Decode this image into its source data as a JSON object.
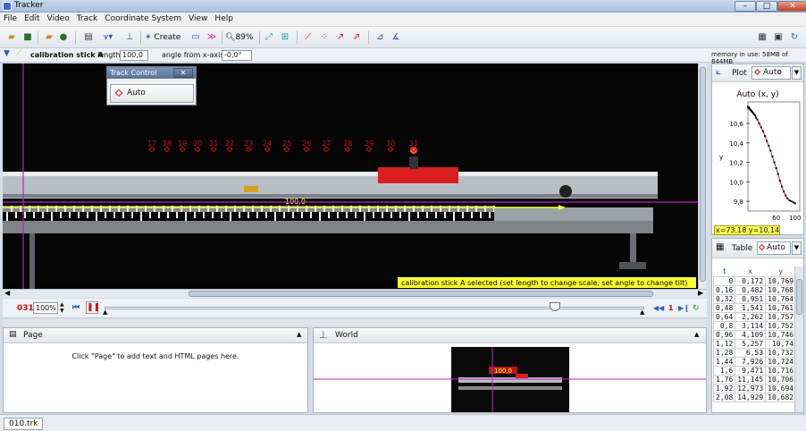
{
  "window": {
    "title": "Tracker",
    "min": "–",
    "max": "□",
    "close": "✕"
  },
  "menu": [
    "File",
    "Edit",
    "Video",
    "Track",
    "Coordinate System",
    "View",
    "Help"
  ],
  "toolbar": {
    "create_label": "Create",
    "zoom_label": "89%"
  },
  "calibration": {
    "track_name": "calibration stick A",
    "length_label": "length",
    "length_value": "100,0",
    "angle_label": "angle from x-axis",
    "angle_value": "-0,0°"
  },
  "memory": "memory in use: 58MB of 844MB",
  "track_control": {
    "title": "Track Control",
    "close": "✕",
    "button_label": "Auto"
  },
  "video": {
    "point_labels": [
      "17",
      "18",
      "19",
      "20",
      "21",
      "22",
      "23",
      "24",
      "25",
      "26",
      "27",
      "28",
      "29",
      "30",
      "31"
    ],
    "stick_value": "100,0",
    "status_message": "calibration stick A selected (set length to change scale, set angle to change tilt)"
  },
  "player": {
    "frame": "031",
    "rate": "100%",
    "step_size": "1"
  },
  "page_pane": {
    "title": "Page",
    "hint": "Click \"Page\" to add text and HTML pages here."
  },
  "world_pane": {
    "title": "World",
    "thumb_text": "100,0"
  },
  "plot": {
    "plot_label": "Plot",
    "track_label": "Auto",
    "title": "Auto (x, y)",
    "ylabel": "y",
    "y_ticks": [
      "10,6",
      "10,4",
      "10,2",
      "10,0",
      "9,8"
    ],
    "x_ticks": [
      "60",
      "100"
    ],
    "readout": "x=73,18  y=10,14"
  },
  "chart_data": {
    "type": "scatter",
    "title": "Auto (x, y)",
    "ylabel": "y",
    "xlim": [
      0,
      110
    ],
    "ylim": [
      9.7,
      10.82
    ],
    "x": [
      0.172,
      0.482,
      0.951,
      1.541,
      2.262,
      3.114,
      4.109,
      5.257,
      6.53,
      7.926,
      9.471,
      11.145,
      12.973,
      14.929,
      17.2,
      20,
      24,
      28,
      32,
      36,
      40,
      44,
      48,
      52,
      56,
      60,
      64,
      68,
      72,
      76,
      80,
      84,
      88,
      92,
      96,
      100
    ],
    "y": [
      10.769,
      10.768,
      10.764,
      10.761,
      10.757,
      10.752,
      10.746,
      10.74,
      10.732,
      10.724,
      10.716,
      10.706,
      10.694,
      10.682,
      10.66,
      10.64,
      10.6,
      10.56,
      10.52,
      10.47,
      10.42,
      10.37,
      10.32,
      10.26,
      10.2,
      10.14,
      10.08,
      10.01,
      9.95,
      9.9,
      9.86,
      9.83,
      9.81,
      9.8,
      9.79,
      9.78
    ]
  },
  "table_pane": {
    "table_label": "Table",
    "track_label": "Auto",
    "columns": [
      "t",
      "x",
      "y"
    ],
    "rows": [
      [
        "0",
        "0,172",
        "10,769"
      ],
      [
        "0,16",
        "0,482",
        "10,768"
      ],
      [
        "0,32",
        "0,951",
        "10,764"
      ],
      [
        "0,48",
        "1,541",
        "10,761"
      ],
      [
        "0,64",
        "2,262",
        "10,757"
      ],
      [
        "0,8",
        "3,114",
        "10,752"
      ],
      [
        "0,96",
        "4,109",
        "10,746"
      ],
      [
        "1,12",
        "5,257",
        "10,74"
      ],
      [
        "1,28",
        "6,53",
        "10,732"
      ],
      [
        "1,44",
        "7,926",
        "10,724"
      ],
      [
        "1,6",
        "9,471",
        "10,716"
      ],
      [
        "1,76",
        "11,145",
        "10,706"
      ],
      [
        "1,92",
        "12,973",
        "10,694"
      ],
      [
        "2,08",
        "14,929",
        "10,682"
      ]
    ]
  },
  "status": {
    "file_tab": "010.trk"
  },
  "colors": {
    "track": "#d01010",
    "axis": "#c020c0",
    "selection": "#ffff33"
  }
}
